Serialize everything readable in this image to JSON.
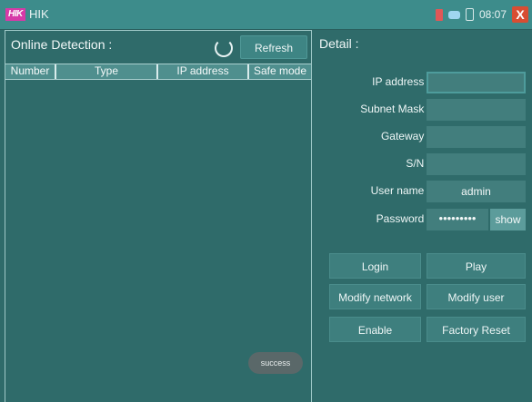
{
  "app": {
    "logo_text": "HIK",
    "title": "HIK",
    "time": "08:07",
    "close_label": "X"
  },
  "left": {
    "title": "Online Detection :",
    "refresh_label": "Refresh",
    "columns": [
      "Number",
      "Type",
      "IP address",
      "Safe mode"
    ],
    "rows": [],
    "toast": "success"
  },
  "detail": {
    "title": "Detail :",
    "fields": [
      {
        "label": "IP address :",
        "value": ""
      },
      {
        "label": "Subnet Mask :",
        "value": ""
      },
      {
        "label": "Gateway :",
        "value": ""
      },
      {
        "label": "S/N :",
        "value": ""
      },
      {
        "label": "User name :",
        "value": "admin"
      }
    ],
    "password_label": "Password :",
    "password_value": "•••••••••",
    "show_label": "show",
    "buttons": {
      "login": "Login",
      "play": "Play",
      "modify_network": "Modify network",
      "modify_user": "Modify user",
      "enable": "Enable",
      "factory_reset": "Factory Reset"
    }
  }
}
